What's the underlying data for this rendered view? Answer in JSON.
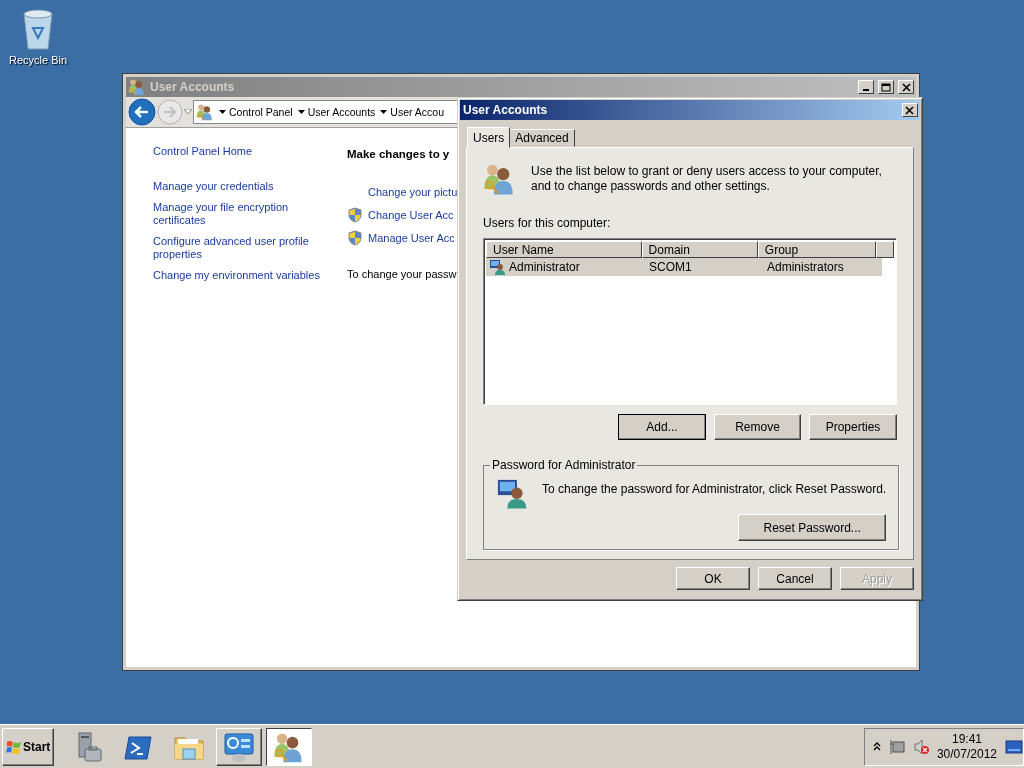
{
  "desktop_icons": [
    {
      "label": "Recycle Bin"
    }
  ],
  "main_window": {
    "title": "User Accounts",
    "active": false,
    "breadcrumb": [
      "Control Panel",
      "User Accounts",
      "User Accou"
    ],
    "sidebar_links": [
      "Control Panel Home",
      "Manage your credentials",
      "Manage your file encryption\ncertificates",
      "Configure advanced user profile\nproperties",
      "Change my environment variables"
    ],
    "heading": "Make changes to y",
    "tasks": [
      {
        "label": "Change your pictu",
        "kind": "plain"
      },
      {
        "label": "Change User Acc",
        "kind": "shield"
      },
      {
        "label": "Manage User Acc",
        "kind": "shield"
      }
    ],
    "note": "To change your passw"
  },
  "dialog": {
    "title": "User Accounts",
    "tabs": [
      {
        "label": "Users",
        "selected": true
      },
      {
        "label": "Advanced",
        "selected": false
      }
    ],
    "intro": "Use the list below to grant or deny users access to your computer,\nand to change passwords and other settings.",
    "list_label": "Users for this computer:",
    "columns": [
      "User Name",
      "Domain",
      "Group"
    ],
    "rows": [
      {
        "cells": [
          "Administrator",
          "SCOM1",
          "Administrators"
        ],
        "selected": true
      }
    ],
    "list_buttons": [
      {
        "label": "Add...",
        "focused": true
      },
      {
        "label": "Remove",
        "focused": false
      },
      {
        "label": "Properties",
        "focused": false
      }
    ],
    "password_group": {
      "title": "Password for Administrator",
      "text": "To change the password for Administrator, click Reset Password.",
      "button": "Reset Password..."
    },
    "buttons": [
      {
        "label": "OK",
        "disabled": false
      },
      {
        "label": "Cancel",
        "disabled": false
      },
      {
        "label": "Apply",
        "disabled": true
      }
    ]
  },
  "taskbar": {
    "start": "Start",
    "apps": [
      {
        "kind": "server",
        "open": false,
        "selected": false
      },
      {
        "kind": "shell",
        "open": false,
        "selected": false
      },
      {
        "kind": "folder",
        "open": false,
        "selected": false
      },
      {
        "kind": "panel",
        "open": true,
        "selected": false
      },
      {
        "kind": "users",
        "open": true,
        "selected": true
      }
    ],
    "clock": {
      "time": "19:41",
      "date": "30/07/2012"
    }
  }
}
